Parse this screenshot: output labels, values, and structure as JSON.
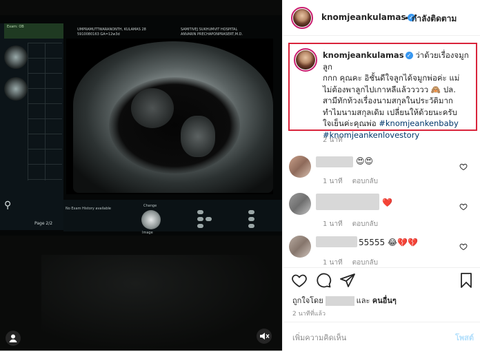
{
  "media": {
    "scan_header": {
      "left_line1": "UMPRAMUTTWARANONTH, KULAMAS 28",
      "left_line2": "5910080163  GA=12w3d",
      "right_line1": "SAMITIVEJ SUKHUMVIT HOSPITAL",
      "right_line2": "ANVARIN PRECHAPONPRASERT,M.D."
    },
    "exam_box": "Exam: OB",
    "no_history": "No Exam History available",
    "page_label": "Page 2/2",
    "change_label": "Change",
    "image_label": "Image",
    "mute_icon": "speaker-muted-icon",
    "user_icon": "user-tag-icon"
  },
  "header": {
    "username": "knomjeankulamas",
    "separator": "•",
    "follow_label": "กำลังติดตาม",
    "verified_icon": "verified-badge-icon"
  },
  "caption": {
    "username": "knomjeankulamas",
    "line1": "ว่าด้วยเรื่องจมูกลูก",
    "line2": "กกก คุณคะ อิชั้นดีใจลูกได้จมูกพ่อค่ะ แม่",
    "line3": "ไม่ต้องพาลูกไปเกาหลีแล้ววววว 🙈 ปล.",
    "line4": "สามีทักท้วงเรื่องนามสกุลในประวัติมาก",
    "line5": "ทำไมนามสกุลเดิม เปลี่ยนให้ด้วยนะครับ",
    "line6": "ใจเย็นค่ะคุณพ่อ",
    "tag1": "#knomjeankenbaby",
    "tag2": "#knomjeankenlovestory",
    "time": "2 นาที"
  },
  "comments": [
    {
      "text": "😍😍",
      "time": "1 นาที",
      "reply": "ตอบกลับ"
    },
    {
      "text": "❤️",
      "time": "1 นาที",
      "reply": "ตอบกลับ"
    },
    {
      "text": "55555 😂💔💔",
      "time": "1 นาที",
      "reply": "ตอบกลับ"
    }
  ],
  "actions": {
    "liked_by": "ถูกใจโดย",
    "and": "และ",
    "others": "คนอื่นๆ",
    "time_ago": "2 นาทีที่แล้ว",
    "add_comment_placeholder": "เพิ่มความคิดเห็น",
    "post_label": "โพสต์"
  },
  "colors": {
    "accent": "#3897f0",
    "highlight_border": "#d9233a",
    "hashtag": "#00376b"
  }
}
